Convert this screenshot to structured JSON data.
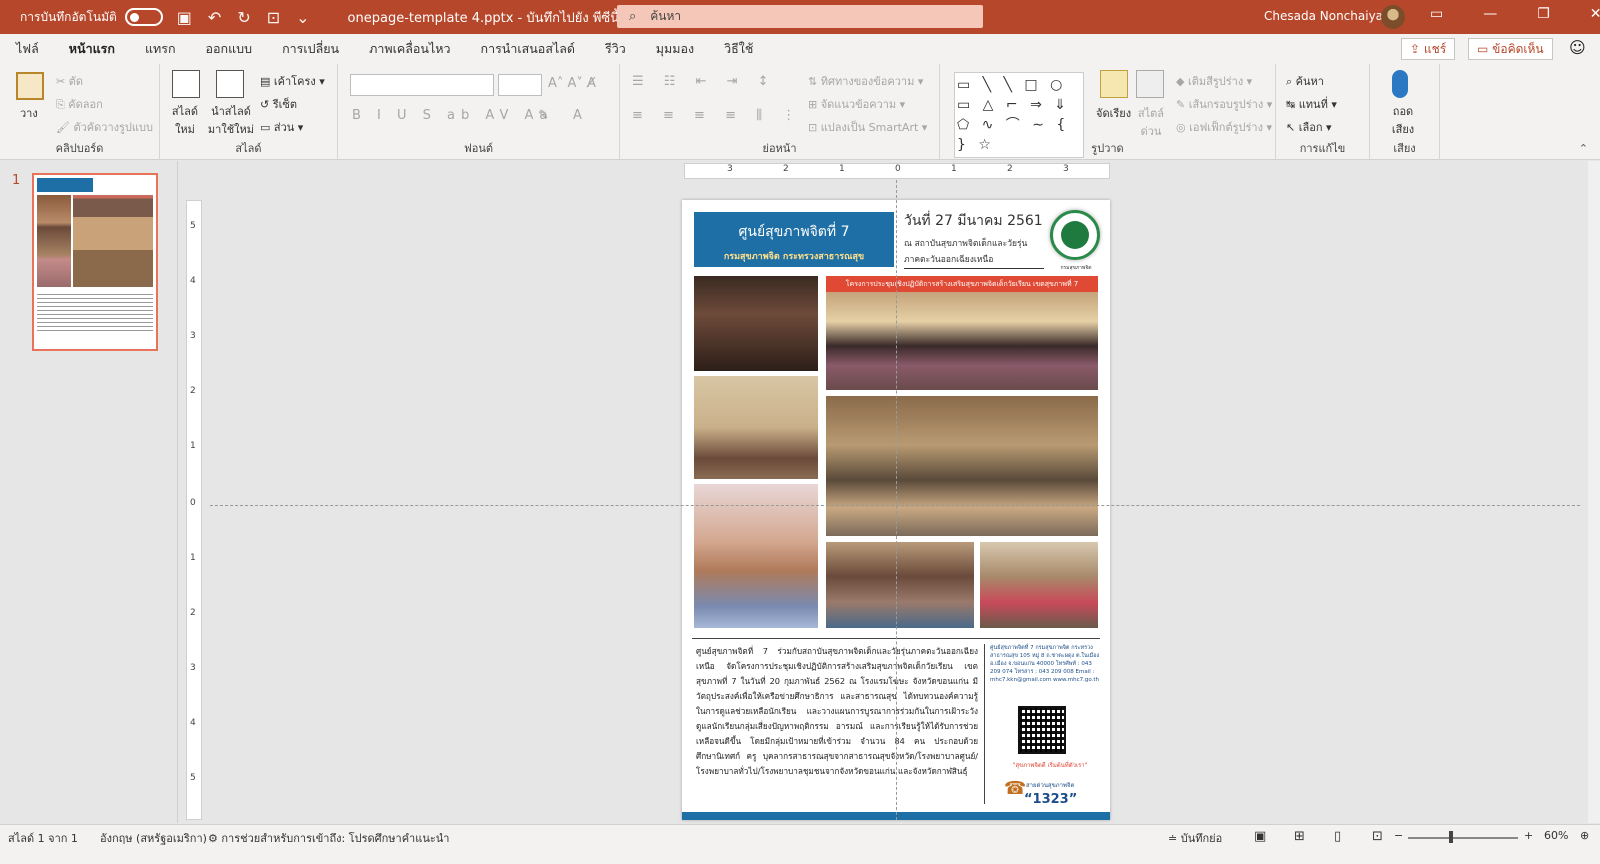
{
  "titlebar": {
    "autosave_label": "การบันทึกอัตโนมัติ",
    "document_title": "onepage-template 4.pptx  -  บันทึกไปยัง พีซีนี้",
    "search_placeholder": "ค้นหา",
    "user_name": "Chesada Nonchaiya"
  },
  "tabs": [
    "ไฟล์",
    "หน้าแรก",
    "แทรก",
    "ออกแบบ",
    "การเปลี่ยน",
    "ภาพเคลื่อนไหว",
    "การนำเสนอสไลด์",
    "รีวิว",
    "มุมมอง",
    "วิธีใช้"
  ],
  "active_tab": "หน้าแรก",
  "share_label": "แชร์",
  "comments_label": "ข้อคิดเห็น",
  "ribbon": {
    "clipboard": {
      "label": "คลิปบอร์ด",
      "paste": "วาง",
      "cut": "ตัด",
      "copy": "คัดลอก",
      "format_painter": "ตัวคัดวางรูปแบบ"
    },
    "slides": {
      "label": "สไลด์",
      "new_slide": "สไลด์ ใหม่",
      "reuse": "นำสไลด์ มาใช้ใหม่",
      "layout": "เค้าโครง",
      "reset": "รีเซ็ต",
      "section": "ส่วน"
    },
    "font": {
      "label": "ฟอนต์"
    },
    "paragraph": {
      "label": "ย่อหน้า",
      "text_direction": "ทิศทางของข้อความ",
      "align_text": "จัดแนวข้อความ",
      "smartart": "แปลงเป็น SmartArt"
    },
    "drawing": {
      "label": "รูปวาด",
      "arrange": "จัดเรียง",
      "quick_styles": "สไตล์ ด่วน",
      "fill": "เติมสีรูปร่าง",
      "outline": "เส้นกรอบรูปร่าง",
      "effects": "เอฟเฟ็กต์รูปร่าง"
    },
    "editing": {
      "label": "การแก้ไข",
      "find": "ค้นหา",
      "replace": "แทนที่",
      "select": "เลือก"
    },
    "voice": {
      "label": "เสียง",
      "dictate": "ถอด เสียง"
    }
  },
  "thumbnail": {
    "number": "1"
  },
  "ruler": {
    "h_labels": [
      "3",
      "2",
      "1",
      "0",
      "1",
      "2",
      "3"
    ],
    "v_labels": [
      "5",
      "4",
      "3",
      "2",
      "1",
      "0",
      "1",
      "2",
      "3",
      "4",
      "5"
    ]
  },
  "slide": {
    "header_title": "ศูนย์สุขภาพจิตที่ 7",
    "header_subtitle": "กรมสุขภาพจิต กระทรวงสาธารณสุข",
    "date": "วันที่ 27 มีนาคม 2561",
    "venue_line1": "ณ สถาบันสุขภาพจิตเด็กและวัยรุ่น",
    "venue_line2": "ภาคตะวันออกเฉียงเหนือ",
    "logo_caption": "กรมสุขภาพจิต",
    "banner": "โครงการประชุมเชิงปฏิบัติการสร้างเสริมสุขภาพจิตเด็กวัยเรียน เขตสุขภาพที่ 7",
    "body": "ศูนย์สุขภาพจิตที่ 7 ร่วมกับสถาบันสุขภาพจิตเด็กและวัยรุ่นภาคตะวันออกเฉียงเหนือ จัดโครงการประชุมเชิงปฏิบัติการสร้างเสริมสุขภาพจิตเด็กวัยเรียน เขตสุขภาพที่ 7 ในวันที่ 20 กุมภาพันธ์ 2562 ณ โรงแรมโฆษะ จังหวัดขอนแก่น มีวัตถุประสงค์เพื่อให้เครือข่ายศึกษาธิการ และสาธารณสุข ได้ทบทวนองค์ความรู้ในการดูแลช่วยเหลือนักเรียน และวางแผนการบูรณาการร่วมกันในการเฝ้าระวังดูแลนักเรียนกลุ่มเสี่ยงปัญหาพฤติกรรม อารมณ์ และการเรียนรู้ให้ได้รับการช่วยเหลือจนดีขึ้น โดยมีกลุ่มเป้าหมายที่เข้าร่วม จำนวน 84 คน ประกอบด้วย ศึกษานิเทศก์ ครู บุคลากรสาธารณสุขจากสาธารณสุขจังหวัด/โรงพยาบาลศูนย์/โรงพยาบาลทั่วไป/โรงพยาบาลชุมชนจากจังหวัดขอนแก่น และจังหวัดกาฬสินธุ์",
    "contact": "ศูนย์สุขภาพจิตที่ 7 กรมสุขภาพจิต กระทรวงสาธารณสุข 105 หมู่ 8 ถ.ชาตะผดุง ต.ในเมือง อ.เมือง จ.ขอนแก่น 40000 โทรศัพท์ : 043 209 074 โทรสาร : 043 209 008 Email : mhc7.kkn@gmail.com www.mhc7.go.th",
    "slogan": "\"สุขภาพจิตดี เริ่มต้นที่ตัวเรา\"",
    "hotline_label": "สายด่วนสุขภาพจิต",
    "hotline_number": "“1323”"
  },
  "statusbar": {
    "slide_info": "สไลด์ 1 จาก 1",
    "language": "อังกฤษ (สหรัฐอเมริกา)",
    "accessibility": "การช่วยสำหรับการเข้าถึง: โปรดศึกษาคำแนะนำ",
    "notes": "บันทึกย่อ",
    "zoom": "60%"
  },
  "colors": {
    "accent": "#b7472a",
    "header_blue": "#1d6fa5",
    "banner_red": "#e04a35"
  }
}
